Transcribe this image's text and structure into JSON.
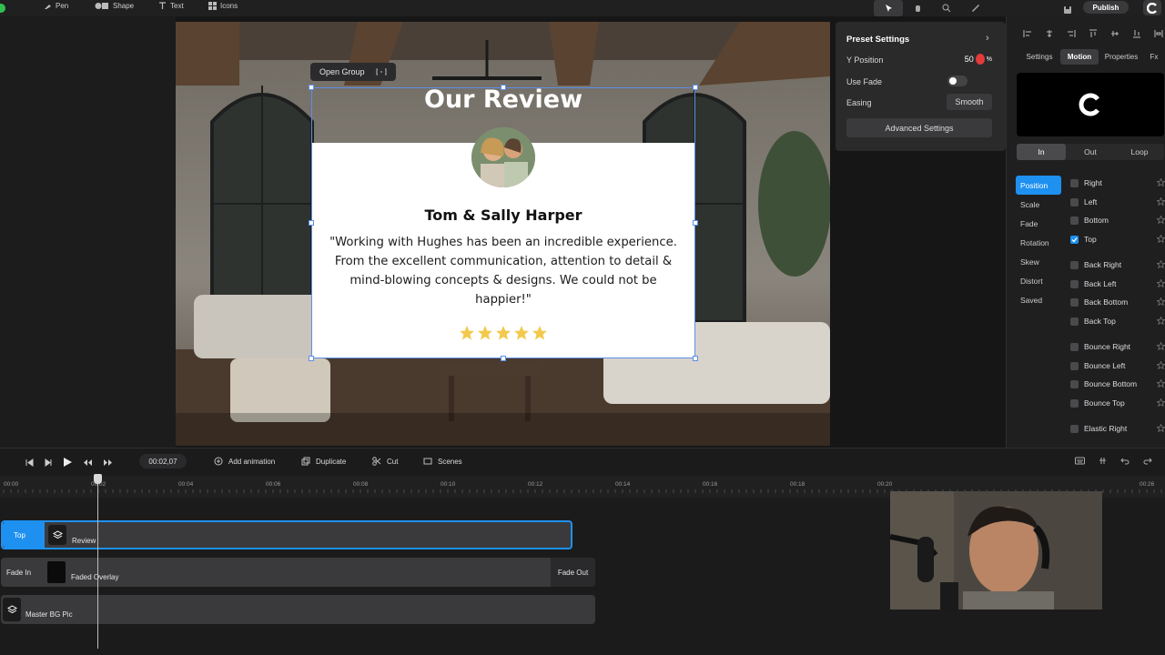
{
  "toolbar": {
    "pen": "Pen",
    "shape": "Shape",
    "text": "Text",
    "icons": "Icons",
    "publish": "Publish"
  },
  "canvas": {
    "open_group": "Open Group",
    "heading": "Our Review",
    "name": "Tom & Sally Harper",
    "quote": "\"Working with Hughes has been an incredible experience. From the excellent communication, attention to detail & mind-blowing concepts & designs. We could not be happier!\"",
    "rating": 5
  },
  "preset": {
    "title": "Preset Settings",
    "y_position_label": "Y Position",
    "y_position_value": "50",
    "y_position_unit": "%",
    "use_fade_label": "Use Fade",
    "use_fade_on": false,
    "easing_label": "Easing",
    "easing_value": "Smooth",
    "advanced": "Advanced Settings"
  },
  "inspector": {
    "tabs": [
      "Settings",
      "Motion",
      "Properties",
      "Fx"
    ],
    "active_tab": "Motion",
    "subtabs": [
      "In",
      "Out",
      "Loop"
    ],
    "active_subtab": "In",
    "categories": [
      "Position",
      "Scale",
      "Fade",
      "Rotation",
      "Skew",
      "Distort",
      "Saved"
    ],
    "active_category": "Position",
    "options": [
      {
        "label": "Right",
        "checked": false
      },
      {
        "label": "Left",
        "checked": false
      },
      {
        "label": "Bottom",
        "checked": false
      },
      {
        "label": "Top",
        "checked": true
      },
      {
        "label": "Back Right",
        "checked": false
      },
      {
        "label": "Back Left",
        "checked": false
      },
      {
        "label": "Back Bottom",
        "checked": false
      },
      {
        "label": "Back Top",
        "checked": false
      },
      {
        "label": "Bounce Right",
        "checked": false
      },
      {
        "label": "Bounce Left",
        "checked": false
      },
      {
        "label": "Bounce Bottom",
        "checked": false
      },
      {
        "label": "Bounce Top",
        "checked": false
      },
      {
        "label": "Elastic Right",
        "checked": false
      }
    ]
  },
  "timeline": {
    "time": "00:02,07",
    "add_animation": "Add animation",
    "duplicate": "Duplicate",
    "cut": "Cut",
    "scenes": "Scenes",
    "ruler": [
      "00:00",
      "00:02",
      "00:04",
      "00:06",
      "00:08",
      "00:10",
      "00:12",
      "00:14",
      "00:16",
      "00:18",
      "00:20",
      "00:26"
    ],
    "tracks": [
      {
        "in_label": "Top",
        "name": "Review",
        "out_label": ""
      },
      {
        "in_label": "Fade In",
        "name": "Faded Overlay",
        "out_label": "Fade Out"
      },
      {
        "in_label": "",
        "name": "Master BG Pic",
        "out_label": ""
      }
    ]
  },
  "colors": {
    "accent": "#1e90f0",
    "star": "#f2c94c",
    "panel": "#2a2a2b"
  }
}
